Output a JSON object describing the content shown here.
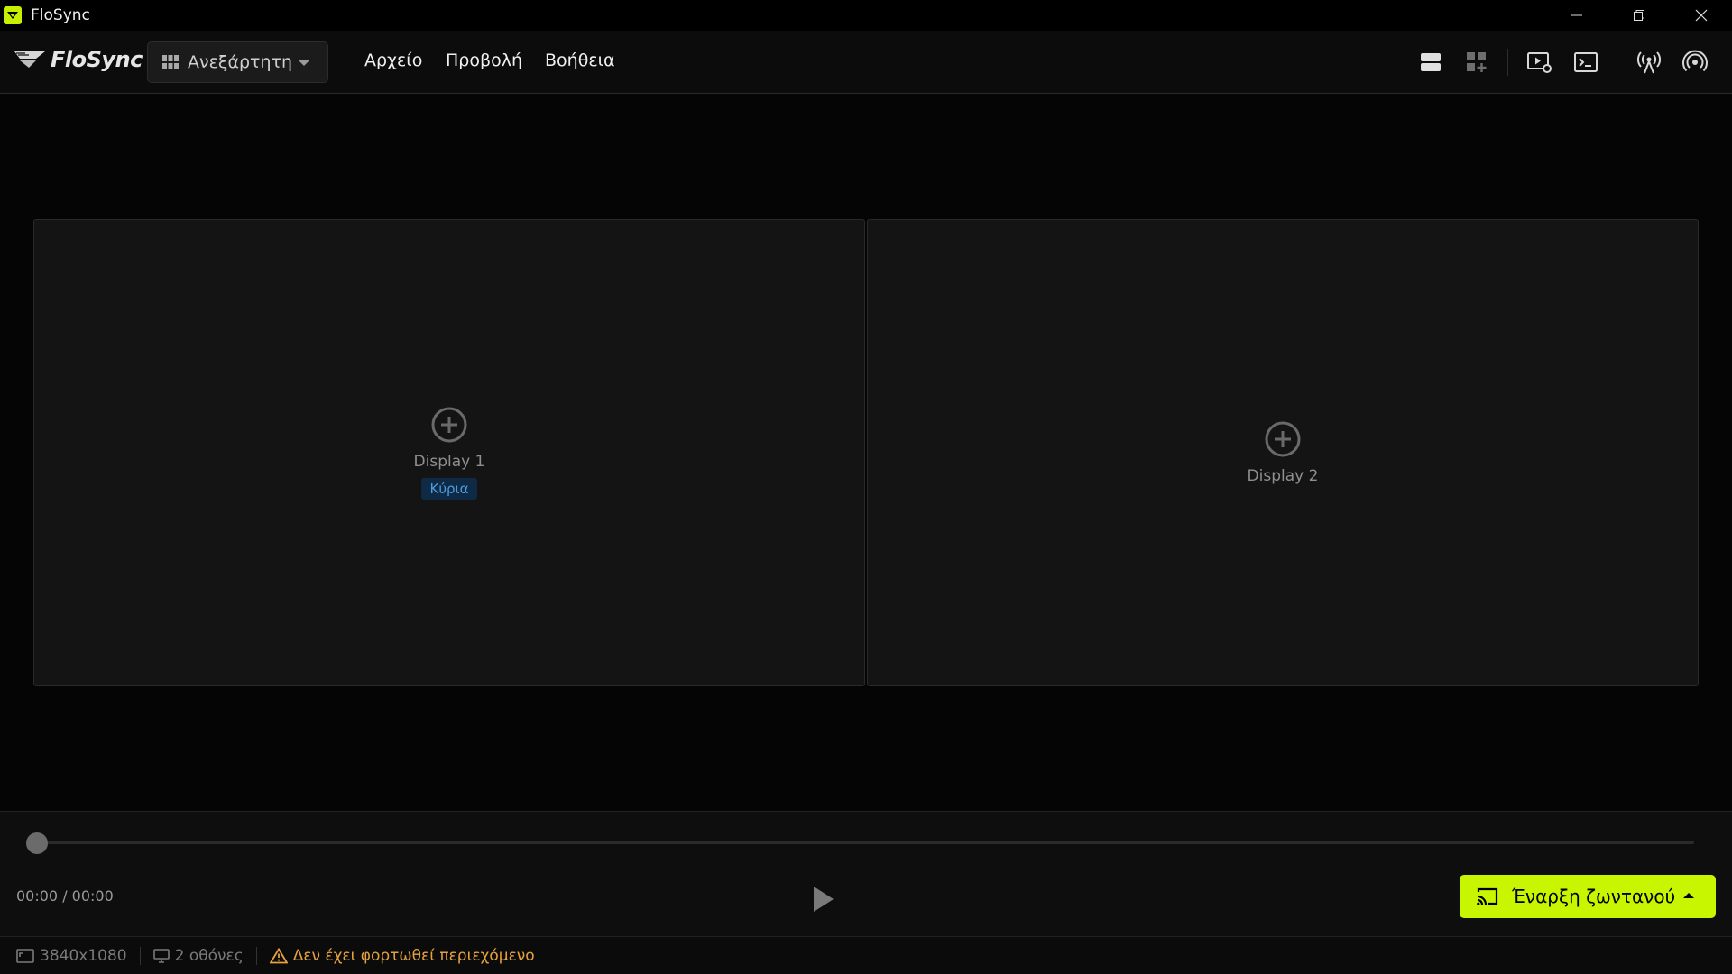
{
  "window": {
    "title": "FloSync"
  },
  "menubar": {
    "logo_text": "FloSync",
    "mode_label": "Ανεξάρτητη",
    "menu_items": [
      "Αρχείο",
      "Προβολή",
      "Βοήθεια"
    ]
  },
  "toolbar": {
    "icons": [
      "layout-rows-icon",
      "add-widget-icon",
      "media-settings-icon",
      "terminal-icon",
      "broadcast-tower-icon",
      "signal-icon"
    ]
  },
  "displays": [
    {
      "label": "Display 1",
      "badge": "Κύρια"
    },
    {
      "label": "Display 2",
      "badge": ""
    }
  ],
  "playback": {
    "time": "00:00 / 00:00",
    "progress": 0
  },
  "live_button": {
    "label": "Έναρξη ζωντανού"
  },
  "status": {
    "resolution": "3840x1080",
    "screens": "2 οθόνες",
    "warning": "Δεν έχει φορτωθεί περιεχόμενο"
  },
  "colors": {
    "accent": "#c8f500",
    "badge_bg": "#0f2a44",
    "badge_text": "#4d9be0",
    "warning": "#e6a23c"
  }
}
